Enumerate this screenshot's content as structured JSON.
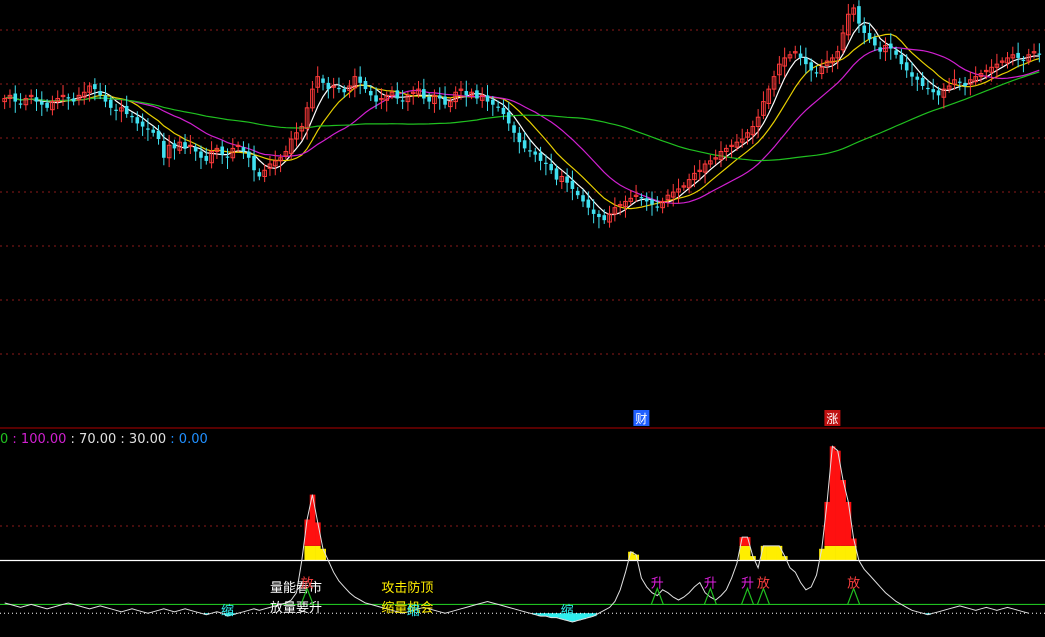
{
  "colors": {
    "background": "#000000",
    "candle_up": "#ff3b3b",
    "candle_down": "#40e0f0",
    "ma5": "#ffffff",
    "ma10": "#e8d000",
    "ma20": "#d020d0",
    "ma60": "#20c020",
    "grid": "#8b1a1a",
    "divider": "#b00000",
    "osc_line": "#e0e0e0",
    "level_high": "#ffffff",
    "level_low": "#20c020",
    "fill_red": "#ff1010",
    "fill_yellow": "#ffee00",
    "fill_cyan": "#30f0f0",
    "signal_up": "#20c020",
    "signal_text": "#ff4040"
  },
  "badges": [
    {
      "text": "财",
      "bar": 120,
      "color": "#2060ff"
    },
    {
      "text": "涨",
      "bar": 156,
      "color": "#c01010"
    }
  ],
  "indicator_header": {
    "v0": "0",
    "v1": ": 100.00",
    "v2": ": 70.00",
    "v3": ": 30.00",
    "v4": ": 0.00"
  },
  "indicator_header_colors": [
    "#20c020",
    "#d020d0",
    "#e0e0e0",
    "#e0e0e0",
    "#2090ff"
  ],
  "annotations": [
    {
      "text": "量能看市",
      "bar": 50,
      "row": 0,
      "color": "#ffffff"
    },
    {
      "text": "放量要升",
      "bar": 50,
      "row": 1,
      "color": "#ffffff"
    },
    {
      "text": "攻击防顶",
      "bar": 71,
      "row": 0,
      "color": "#ffee00"
    },
    {
      "text": "缩量机会",
      "bar": 71,
      "row": 1,
      "color": "#ffee00"
    }
  ],
  "signal_labels": [
    {
      "text": "放",
      "bar": 57,
      "color": "#ff4040"
    },
    {
      "text": "升",
      "bar": 123,
      "color": "#e020e0"
    },
    {
      "text": "升",
      "bar": 133,
      "color": "#e020e0"
    },
    {
      "text": "升",
      "bar": 140,
      "color": "#e020e0"
    },
    {
      "text": "放",
      "bar": 143,
      "color": "#ff4040"
    },
    {
      "text": "放",
      "bar": 160,
      "color": "#ff4040"
    }
  ],
  "cyan_labels": [
    {
      "text": "缩",
      "bar": 42
    },
    {
      "text": "缩",
      "bar": 77
    },
    {
      "text": "缩",
      "bar": 106
    }
  ],
  "chart_data": {
    "type": "candlestick",
    "bar_count": 196,
    "price_range": [
      0,
      100
    ],
    "indicator_range": [
      -12,
      100
    ],
    "indicator_levels": {
      "upper": 30,
      "lower": 0
    },
    "price_close": [
      71,
      72,
      70,
      69,
      71,
      72,
      70,
      69,
      68,
      70,
      71,
      72,
      71,
      70,
      72,
      73,
      75,
      74,
      72,
      70,
      68,
      67,
      68,
      66,
      65,
      63,
      62,
      61,
      60,
      58,
      52,
      56,
      55,
      57,
      55,
      56,
      54,
      52,
      51,
      54,
      55,
      53,
      52,
      55,
      56,
      54,
      52,
      48,
      46,
      48,
      50,
      51,
      52,
      54,
      58,
      60,
      62,
      68,
      74,
      78,
      76,
      74,
      75,
      74,
      73,
      75,
      78,
      76,
      74,
      72,
      70,
      71,
      72,
      73,
      71,
      70,
      72,
      73,
      74,
      71,
      70,
      72,
      71,
      69,
      70,
      73,
      74,
      72,
      73,
      71,
      72,
      70,
      69,
      68,
      66,
      63,
      60,
      57,
      55,
      54,
      53,
      51,
      50,
      48,
      45,
      46,
      44,
      42,
      40,
      38,
      36,
      34,
      33,
      32,
      34,
      36,
      37,
      38,
      39,
      40,
      39,
      38,
      37,
      36,
      38,
      40,
      41,
      42,
      43,
      45,
      47,
      48,
      50,
      51,
      52,
      54,
      55,
      56,
      57,
      58,
      60,
      62,
      65,
      70,
      74,
      78,
      82,
      84,
      85,
      86,
      84,
      82,
      80,
      79,
      81,
      83,
      84,
      86,
      92,
      98,
      100,
      95,
      92,
      90,
      88,
      86,
      88,
      87,
      85,
      82,
      80,
      78,
      77,
      75,
      74,
      73,
      72,
      74,
      75,
      77,
      76,
      75,
      77,
      78,
      79,
      80,
      81,
      82,
      83,
      84,
      85,
      84,
      83,
      85,
      86,
      85
    ],
    "indicator_values": [
      1,
      0,
      -1,
      -2,
      -1,
      0,
      -1,
      -2,
      -3,
      -2,
      -1,
      0,
      1,
      0,
      -1,
      -2,
      -3,
      -2,
      -1,
      -2,
      -3,
      -4,
      -5,
      -4,
      -3,
      -4,
      -5,
      -6,
      -5,
      -4,
      -3,
      -4,
      -5,
      -4,
      -3,
      -4,
      -5,
      -6,
      -7,
      -6,
      -5,
      -6,
      -8,
      -7,
      -6,
      -5,
      -4,
      -3,
      -4,
      -3,
      -2,
      -1,
      0,
      1,
      3,
      8,
      30,
      58,
      75,
      56,
      38,
      30,
      22,
      16,
      12,
      8,
      5,
      3,
      1,
      0,
      -1,
      -2,
      -3,
      -4,
      -5,
      -6,
      -5,
      -4,
      -3,
      -2,
      -3,
      -4,
      -5,
      -6,
      -5,
      -4,
      -3,
      -2,
      -1,
      0,
      1,
      2,
      1,
      0,
      -1,
      -2,
      -3,
      -4,
      -5,
      -6,
      -7,
      -8,
      -8,
      -9,
      -9,
      -10,
      -11,
      -12,
      -11,
      -10,
      -9,
      -8,
      -6,
      -4,
      -2,
      2,
      10,
      22,
      36,
      34,
      18,
      12,
      8,
      6,
      10,
      8,
      5,
      3,
      5,
      8,
      12,
      15,
      8,
      5,
      3,
      6,
      10,
      18,
      28,
      46,
      46,
      33,
      25,
      40,
      40,
      40,
      40,
      33,
      25,
      22,
      15,
      10,
      12,
      20,
      38,
      70,
      108,
      105,
      85,
      70,
      45,
      30,
      24,
      20,
      16,
      12,
      8,
      5,
      2,
      0,
      -2,
      -4,
      -5,
      -6,
      -7,
      -6,
      -5,
      -4,
      -3,
      -2,
      -1,
      -2,
      -3,
      -4,
      -3,
      -2,
      -3,
      -4,
      -3,
      -2,
      -3,
      -4,
      -5,
      -6
    ]
  }
}
